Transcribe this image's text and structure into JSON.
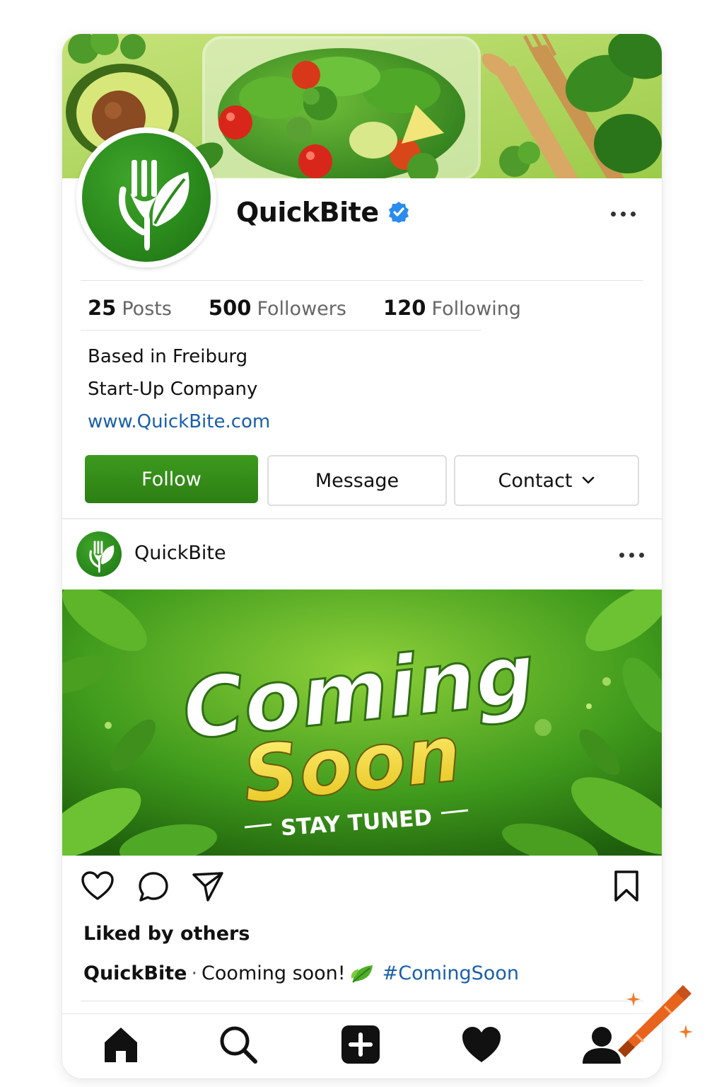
{
  "profile": {
    "name": "QuickBite",
    "verified": true,
    "stats": [
      {
        "value": "25",
        "label": "Posts"
      },
      {
        "value": "500",
        "label": "Followers"
      },
      {
        "value": "120",
        "label": "Following"
      }
    ],
    "bio": {
      "line1": "Based in Freiburg",
      "line2": "Start-Up Company",
      "website": "www.QuickBite.com"
    },
    "buttons": {
      "follow": "Follow",
      "message": "Message",
      "contact": "Contact"
    }
  },
  "post": {
    "username": "QuickBite",
    "image": {
      "headline1": "Coming",
      "headline2": "Soon",
      "subline": "STAY TUNED"
    },
    "likes_text": "Liked by others",
    "caption": {
      "user": "QuickBite",
      "separator": "·",
      "text": "Cooming soon!",
      "hashtag": "#ComingSoon"
    }
  },
  "icons": {
    "more": "more-horizontal-icon",
    "verified": "verified-badge-icon",
    "contact_chevron": "chevron-down-icon",
    "like": "heart-outline-icon",
    "comment": "comment-icon",
    "share": "send-icon",
    "save": "bookmark-icon",
    "nav": [
      "home-icon",
      "search-icon",
      "add-post-icon",
      "heart-filled-icon",
      "profile-icon"
    ]
  },
  "colors": {
    "brand_green": "#2d8a18",
    "link_blue": "#1a5fa8",
    "verified_blue": "#2b8cf0"
  }
}
